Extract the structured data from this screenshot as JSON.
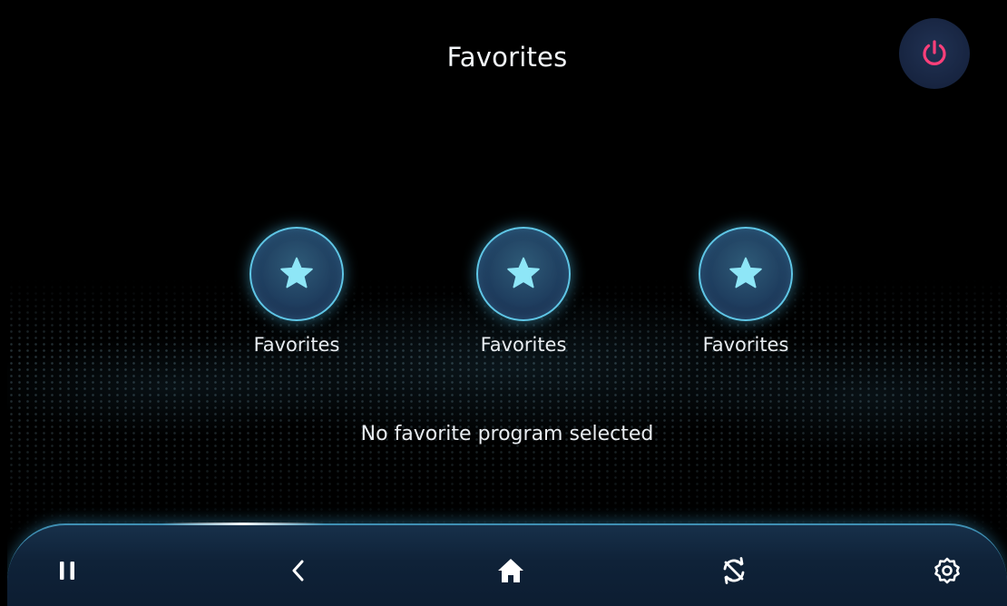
{
  "header": {
    "title": "Favorites",
    "power_icon": "power-icon"
  },
  "favorites": {
    "items": [
      {
        "label": "Favorites",
        "icon": "star-icon"
      },
      {
        "label": "Favorites",
        "icon": "star-icon"
      },
      {
        "label": "Favorites",
        "icon": "star-icon"
      }
    ],
    "status_text": "No favorite program selected"
  },
  "navbar": {
    "items": [
      {
        "name": "pause",
        "icon": "pause-icon"
      },
      {
        "name": "back",
        "icon": "chevron-left-icon"
      },
      {
        "name": "home",
        "icon": "home-icon"
      },
      {
        "name": "sync",
        "icon": "sync-icon"
      },
      {
        "name": "settings",
        "icon": "gear-icon"
      }
    ]
  },
  "colors": {
    "accent": "#5fc6e6",
    "power": "#ff3f7a",
    "navbar": "#0f2238",
    "background": "#000000"
  }
}
